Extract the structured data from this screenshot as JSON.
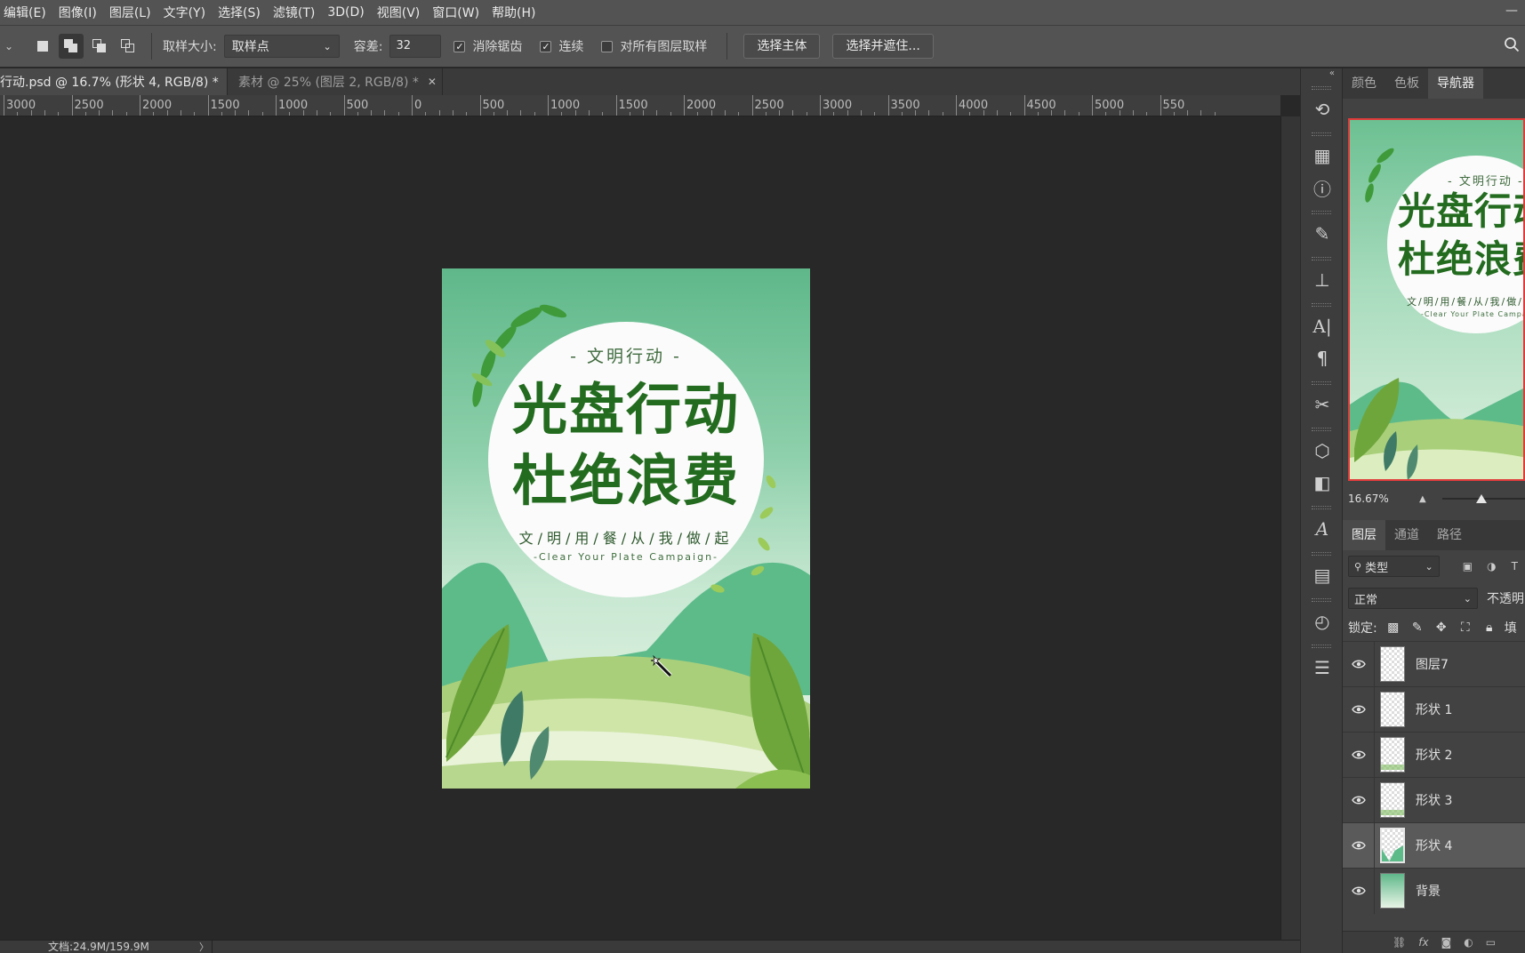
{
  "menu": {
    "items": [
      "编辑(E)",
      "图像(I)",
      "图层(L)",
      "文字(Y)",
      "选择(S)",
      "滤镜(T)",
      "3D(D)",
      "视图(V)",
      "窗口(W)",
      "帮助(H)"
    ]
  },
  "options": {
    "sample_size_label": "取样大小:",
    "sample_size_value": "取样点",
    "tolerance_label": "容差:",
    "tolerance_value": "32",
    "anti_alias_label": "消除锯齿",
    "anti_alias_checked": true,
    "contiguous_label": "连续",
    "contiguous_checked": true,
    "all_layers_label": "对所有图层取样",
    "all_layers_checked": false,
    "select_subject_label": "选择主体",
    "select_mask_label": "选择并遮住..."
  },
  "tabs": [
    {
      "label": "行动.psd @ 16.7% (形状 4, RGB/8) *",
      "active": true
    },
    {
      "label": "素材 @ 25% (图层 2, RGB/8) *",
      "active": false
    }
  ],
  "ruler": {
    "labels": [
      "3000",
      "2500",
      "2000",
      "1500",
      "1000",
      "500",
      "0",
      "500",
      "1000",
      "1500",
      "2000",
      "2500",
      "3000",
      "3500",
      "4000",
      "4500",
      "5000",
      "550"
    ]
  },
  "poster": {
    "subtitle": "- 文明行动 -",
    "title_line1": "光盘行动",
    "title_line2": "杜绝浪费",
    "slogan": "文/明/用/餐/从/我/做/起",
    "english": "-Clear Your Plate Campaign-",
    "colors": {
      "title": "#236c1f",
      "bg_top": "#5fb88a",
      "hill": "#5dbb8a"
    }
  },
  "navigator": {
    "tabs": [
      "颜色",
      "色板",
      "导航器"
    ],
    "active_tab": "导航器",
    "subtitle": "- 文明行动 -",
    "title_line1": "光盘行动",
    "title_line2": "杜绝浪费",
    "slogan": "文/明/用/餐/从/我/做/起",
    "english": "-Clear Your Plate Campaign-",
    "zoom": "16.67%"
  },
  "layers_panel": {
    "tabs": [
      "图层",
      "通道",
      "路径"
    ],
    "active_tab": "图层",
    "filter_label": "类型",
    "blend_mode": "正常",
    "opacity_label": "不透明",
    "lock_label": "锁定:",
    "fill_label": "填",
    "layers": [
      {
        "name": "图层7",
        "selected": false,
        "thumb": "transparent"
      },
      {
        "name": "形状 1",
        "selected": false,
        "thumb": "transparent"
      },
      {
        "name": "形状 2",
        "selected": false,
        "thumb": "band"
      },
      {
        "name": "形状 3",
        "selected": false,
        "thumb": "band"
      },
      {
        "name": "形状 4",
        "selected": true,
        "thumb": "hill"
      },
      {
        "name": "背景",
        "selected": false,
        "thumb": "bg"
      }
    ]
  },
  "status": {
    "doc_size": "文档:24.9M/159.9M"
  },
  "accent": "#e03b3b"
}
